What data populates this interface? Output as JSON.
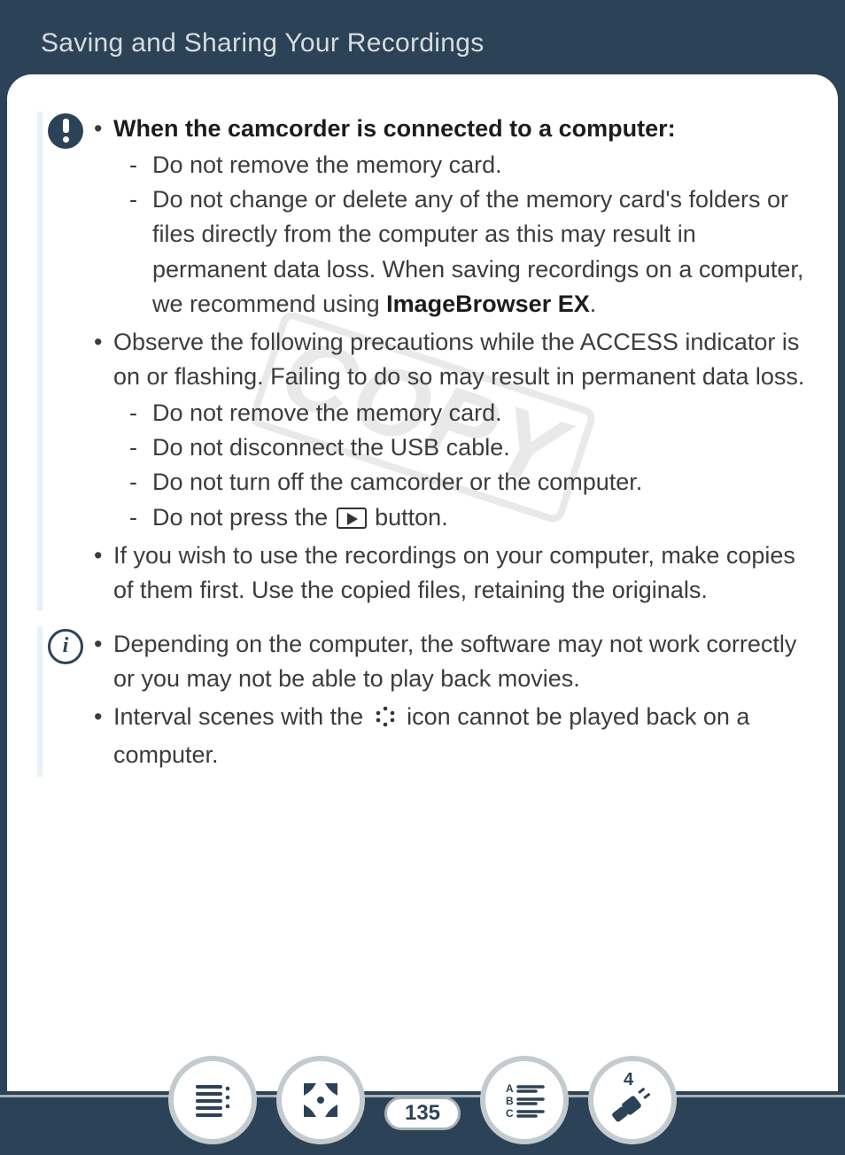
{
  "header": {
    "title": "Saving and Sharing Your Recordings"
  },
  "page_number": "135",
  "watermark": "COPY",
  "important": {
    "bullet1_heading": "When the camcorder is connected to a computer:",
    "bullet1_sub1": "Do not remove the memory card.",
    "bullet1_sub2a": "Do not change or delete any of the memory card's folders or files directly from the computer as this may result in permanent data loss. When saving recordings on a computer, we recommend using ",
    "bullet1_sub2b_bold": "ImageBrowser EX",
    "bullet1_sub2c": ".",
    "bullet2": "Observe the following precautions while the ACCESS indicator is on or flashing. Failing to do so may result in permanent data loss.",
    "bullet2_sub1": "Do not remove the memory card.",
    "bullet2_sub2": "Do not disconnect the USB cable.",
    "bullet2_sub3": "Do not turn off the camcorder or the computer.",
    "bullet2_sub4a": "Do not press the ",
    "bullet2_sub4b": " button.",
    "bullet3": "If you wish to use the recordings on your computer, make copies of them first. Use the copied files, retaining the originals."
  },
  "info": {
    "bullet1": "Depending on the computer, the software may not work correctly or you may not be able to play back movies.",
    "bullet2a": "Interval scenes with the ",
    "bullet2b": " icon cannot be played back on a computer."
  },
  "nav": {
    "toc": "table-of-contents",
    "fullscreen": "fullscreen",
    "index": "index",
    "back": "back",
    "back_badge": "4"
  }
}
